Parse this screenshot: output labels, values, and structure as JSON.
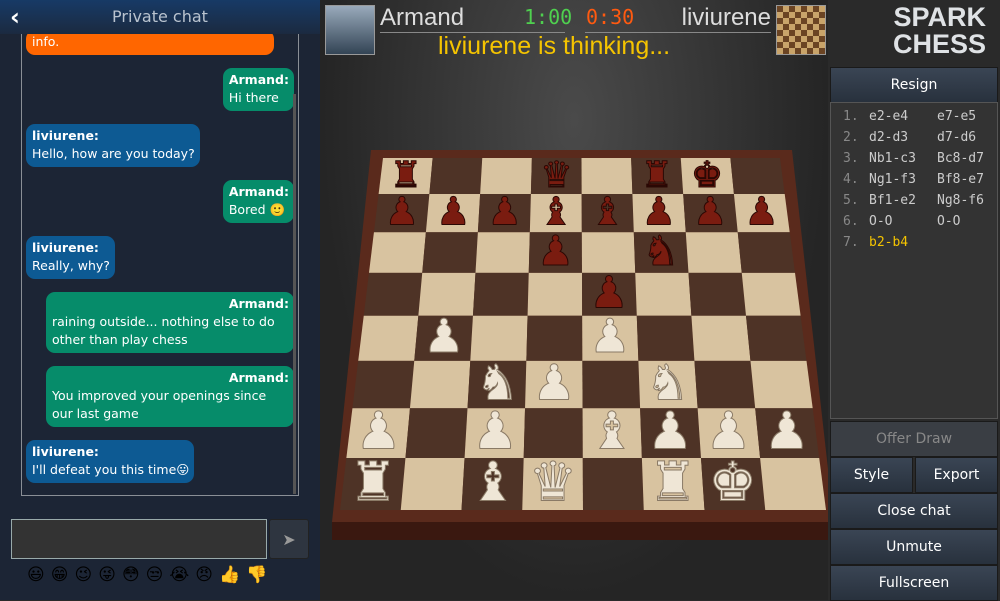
{
  "chat": {
    "title": "Private chat",
    "back_icon": "chevron-left-icon",
    "messages": [
      {
        "type": "system",
        "text": "info."
      },
      {
        "type": "me",
        "author": "Armand:",
        "text": "Hi there"
      },
      {
        "type": "them",
        "author": "liviurene:",
        "text": "Hello, how are you today?"
      },
      {
        "type": "me",
        "author": "Armand:",
        "text": "Bored 🙂"
      },
      {
        "type": "them",
        "author": "liviurene:",
        "text": "Really, why?"
      },
      {
        "type": "me",
        "author": "Armand:",
        "text": "raining outside... nothing else to do other than play chess"
      },
      {
        "type": "me",
        "author": "Armand:",
        "text": "You improved your openings since our last game"
      },
      {
        "type": "them",
        "author": "liviurene:",
        "text": "I'll defeat you this time😛"
      }
    ],
    "input_value": "",
    "send_label": "➤",
    "emojis": [
      "😃",
      "😁",
      "😉",
      "😜",
      "😳",
      "😒",
      "😭",
      "😠",
      "👍",
      "👎"
    ]
  },
  "game": {
    "player_white": "Armand",
    "player_black": "liviurene",
    "clock_white": "1:00",
    "clock_black": "0:30",
    "status": "liviurene is thinking...",
    "colors": {
      "clock_white": "#4fd04f",
      "clock_black": "#ff5a10",
      "status": "#f5c400",
      "accent": "#f5c400"
    },
    "position": {
      "white": {
        "a1": "R",
        "c1": "B",
        "d1": "Q",
        "f1": "R",
        "g1": "K",
        "c3": "N",
        "e2": "B",
        "f3": "N",
        "a2": "P",
        "b4": "P",
        "c2": "P",
        "d3": "P",
        "e4": "P",
        "f2": "P",
        "g2": "P",
        "h2": "P"
      },
      "black": {
        "a8": "R",
        "d8": "Q",
        "f8": "R",
        "g8": "K",
        "d7": "B",
        "e7": "B",
        "f6": "N",
        "a7": "P",
        "b7": "P",
        "c7": "P",
        "d6": "P",
        "e5": "P",
        "f7": "P",
        "g7": "P",
        "h7": "P"
      }
    }
  },
  "logo": {
    "text1": "SPARK",
    "text2": "CHESS"
  },
  "controls": {
    "resign": "Resign",
    "offer_draw": "Offer Draw",
    "style": "Style",
    "export": "Export",
    "close_chat": "Close chat",
    "unmute": "Unmute",
    "fullscreen": "Fullscreen"
  },
  "moves": [
    [
      "1.",
      "e2-e4",
      "e7-e5"
    ],
    [
      "2.",
      "d2-d3",
      "d7-d6"
    ],
    [
      "3.",
      "Nb1-c3",
      "Bc8-d7"
    ],
    [
      "4.",
      "Ng1-f3",
      "Bf8-e7"
    ],
    [
      "5.",
      "Bf1-e2",
      "Ng8-f6"
    ],
    [
      "6.",
      "O-O",
      "O-O"
    ],
    [
      "7.",
      "b2-b4",
      ""
    ]
  ]
}
